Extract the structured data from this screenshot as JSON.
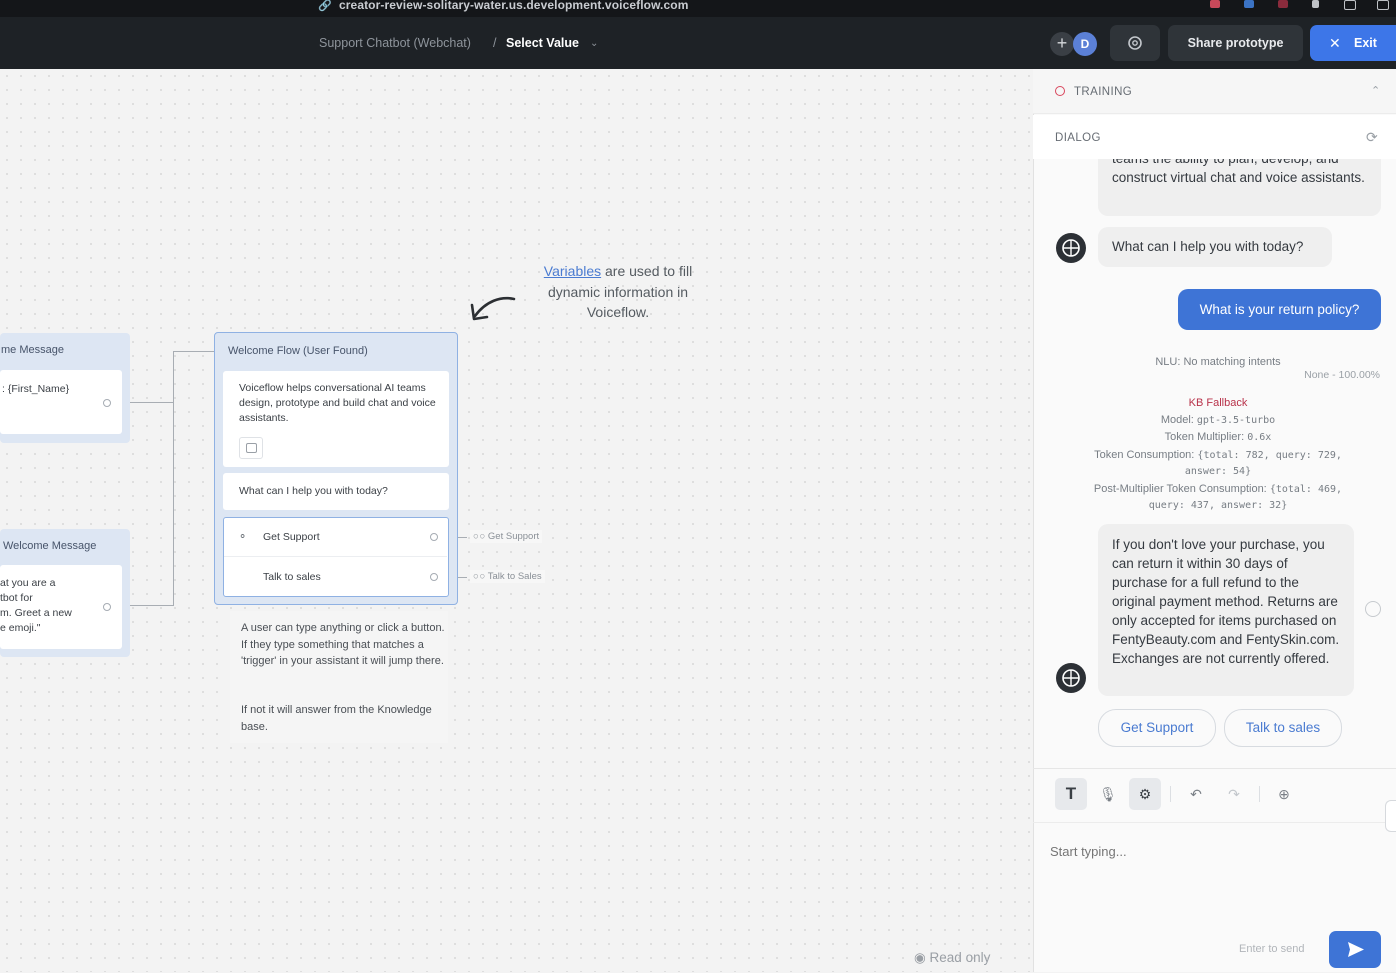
{
  "browser": {
    "url": "creator-review-solitary-water.us.development.voiceflow.com"
  },
  "topbar": {
    "project_name": "Support Chatbot (Webchat)",
    "separator": "/",
    "current_item": "Select Value",
    "avatar_initial": "D",
    "share_label": "Share prototype",
    "exit_label": "Exit",
    "accent_color": "#3d76e8"
  },
  "canvas": {
    "left_node_1": {
      "title": "me Message",
      "text": ": {First_Name}"
    },
    "left_node_2": {
      "title": "Welcome Message",
      "lines": [
        "at you are a",
        "tbot for",
        "m. Greet a new",
        "e emoji.\""
      ]
    },
    "main_node": {
      "title": "Welcome Flow (User Found)",
      "message_1": "Voiceflow helps conversational AI teams design, prototype and build chat and voice assistants.",
      "message_2": "What can I help you with today?",
      "button_1": "Get Support",
      "button_2": "Talk to sales"
    },
    "edge_labels": [
      "Get Support",
      "Talk to Sales"
    ],
    "annotation": {
      "link_text": "Variables",
      "text_rest": " are used to fill dynamic information in Voiceflow."
    },
    "note": {
      "paragraph_1": "A user can type anything or click a button. If they type something that matches a 'trigger' in your assistant it will jump there.",
      "paragraph_2": "If not it will answer from the Knowledge base."
    },
    "read_only_label": "Read only"
  },
  "panel": {
    "training_label": "TRAINING",
    "dialog_label": "DIALOG",
    "messages": {
      "bot_partial_top": "teams the ability to plan, develop, and",
      "bot_partial": "construct virtual chat and voice assistants.",
      "bot_question": "What can I help you with today?",
      "user_question": "What is your return policy?",
      "bot_answer": "If you don't love your purchase, you can return it within 30 days of purchase for a full refund to the original payment method. Returns are only accepted for items purchased on FentyBeauty.com and FentySkin.com. Exchanges are not currently offered."
    },
    "debug": {
      "nlu": "NLU: No matching intents",
      "nlu_score": "None - 100.00%",
      "kb_title": "KB Fallback",
      "model_label": "Model: ",
      "model_value": "gpt-3.5-turbo",
      "multiplier_label": "Token Multiplier: ",
      "multiplier_value": "0.6x",
      "consumption_label": "Token Consumption: ",
      "consumption_value_1": "{total: 782, query: 729,",
      "consumption_value_2": "answer: 54}",
      "post_label": "Post-Multiplier Token Consumption: ",
      "post_value_1": "{total: 469,",
      "post_value_2": "query: 437, answer: 32}",
      "kb_color": "#b8324a"
    },
    "choices": [
      "Get Support",
      "Talk to sales"
    ],
    "input_placeholder": "Start typing...",
    "send_hint": "Enter to send",
    "user_bubble_color": "#3e74d6"
  }
}
